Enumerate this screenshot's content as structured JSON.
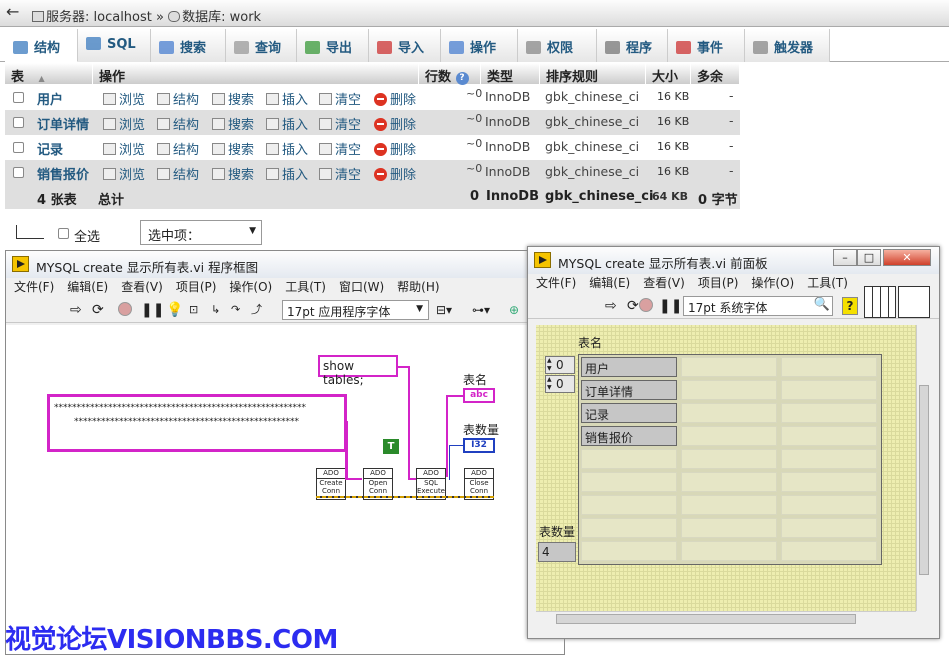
{
  "pma": {
    "breadcrumb": {
      "server": "服务器: localhost »",
      "db": "数据库: work"
    },
    "tabs": [
      {
        "label": "结构",
        "icon": "structure-icon",
        "color": "#3b7bbf"
      },
      {
        "label": "SQL",
        "icon": "sql-icon",
        "color": "#3b7bbf"
      },
      {
        "label": "搜索",
        "icon": "search-icon",
        "color": "#4a7fd0"
      },
      {
        "label": "查询",
        "icon": "query-icon",
        "color": "#999999"
      },
      {
        "label": "导出",
        "icon": "export-icon",
        "color": "#3a9a3a"
      },
      {
        "label": "导入",
        "icon": "import-icon",
        "color": "#cc3333"
      },
      {
        "label": "操作",
        "icon": "wrench-icon",
        "color": "#4a7fd0"
      },
      {
        "label": "权限",
        "icon": "privileges-icon",
        "color": "#888888"
      },
      {
        "label": "程序",
        "icon": "routines-icon",
        "color": "#777777"
      },
      {
        "label": "事件",
        "icon": "events-icon",
        "color": "#cc3333"
      },
      {
        "label": "触发器",
        "icon": "triggers-icon",
        "color": "#888888"
      }
    ],
    "columns": {
      "table": "表",
      "sort_arrow": "▲",
      "actions": "操作",
      "rows": "行数",
      "help": "?",
      "type": "类型",
      "collation": "排序规则",
      "size": "大小",
      "overhead": "多余"
    },
    "actions": {
      "browse": "浏览",
      "structure": "结构",
      "search": "搜索",
      "insert": "插入",
      "empty": "清空",
      "drop": "删除"
    },
    "tables": [
      {
        "name": "用户",
        "rows": "~0",
        "engine": "InnoDB",
        "collation": "gbk_chinese_ci",
        "size": "16 KB",
        "overhead": "-"
      },
      {
        "name": "订单详情",
        "rows": "~0",
        "engine": "InnoDB",
        "collation": "gbk_chinese_ci",
        "size": "16 KB",
        "overhead": "-"
      },
      {
        "name": "记录",
        "rows": "~0",
        "engine": "InnoDB",
        "collation": "gbk_chinese_ci",
        "size": "16 KB",
        "overhead": "-"
      },
      {
        "name": "销售报价",
        "rows": "~0",
        "engine": "InnoDB",
        "collation": "gbk_chinese_ci",
        "size": "16 KB",
        "overhead": "-"
      }
    ],
    "footer": {
      "count": "4 张表",
      "total": "总计",
      "rows": "0",
      "engine": "InnoDB",
      "collation": "gbk_chinese_ci",
      "size": "64 KB",
      "overhead": "0 字节"
    },
    "bulk": {
      "check_all": "全选",
      "select_label": "选中项："
    }
  },
  "bd": {
    "title": "MYSQL create 显示所有表.vi 程序框图",
    "menu": [
      "文件(F)",
      "编辑(E)",
      "查看(V)",
      "项目(P)",
      "操作(O)",
      "工具(T)",
      "窗口(W)",
      "帮助(H)"
    ],
    "font": "17pt 应用程序字体",
    "conn_line1": "********************************************************",
    "conn_line2": "**************************************************",
    "sql": "show tables;",
    "bool_true": "T",
    "label_names": "表名",
    "label_count": "表数量",
    "ind_abc": "abc",
    "ind_i32": "I32",
    "ado_blocks": [
      {
        "h": "ADO",
        "l1": "Create",
        "l2": "Conn"
      },
      {
        "h": "ADO",
        "l1": "Open",
        "l2": "Conn"
      },
      {
        "h": "ADO",
        "l1": "SQL",
        "l2": "Execute"
      },
      {
        "h": "ADO",
        "l1": "Close",
        "l2": "Conn"
      }
    ]
  },
  "fp": {
    "title": "MYSQL create 显示所有表.vi 前面板",
    "menu": [
      "文件(F)",
      "编辑(E)",
      "查看(V)",
      "项目(P)",
      "操作(O)",
      "工具(T)"
    ],
    "font": "17pt 系统字体",
    "label_names": "表名",
    "idx_row": "0",
    "idx_col": "0",
    "cells": [
      "用户",
      "订单详情",
      "记录",
      "销售报价"
    ],
    "label_count": "表数量",
    "count_value": "4"
  },
  "watermark": "视觉论坛VISIONBBS.COM"
}
